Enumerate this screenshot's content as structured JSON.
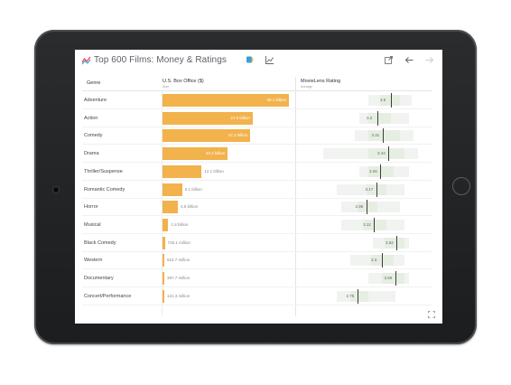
{
  "window": {
    "title": "Top 600 Films: Money & Ratings"
  },
  "icons": {
    "logo": "sparkline-logo-icon",
    "palette": "paint-bucket-icon",
    "chart": "chart-icon",
    "share": "share-icon",
    "back": "back-arrow-icon",
    "forward": "forward-arrow-icon",
    "expand": "expand-icon"
  },
  "colors": {
    "bar": "#f2b24c",
    "accent_logo": "#e2504c",
    "accent_palette": "#3aa0d8"
  },
  "columns": {
    "genre": "Genre",
    "box_office": "U.S. Box Office ($)",
    "box_office_sub": "Sum",
    "rating": "MovieLens Rating",
    "rating_sub": "Average"
  },
  "chart_data": {
    "type": "bar",
    "categories": [
      "Adventure",
      "Action",
      "Comedy",
      "Drama",
      "Thriller/Suspense",
      "Romantic Comedy",
      "Horror",
      "Musical",
      "Black Comedy",
      "Western",
      "Documentary",
      "Concert/Performance"
    ],
    "series": [
      {
        "name": "U.S. Box Office ($)",
        "values": [
          39.1,
          27.9,
          27.2,
          20.2,
          12.1,
          6.1,
          4.8,
          1.8,
          0.7461,
          0.5157,
          0.3977,
          0.1213
        ],
        "labels": [
          "39.1 billion",
          "27.9 billion",
          "27.2 billion",
          "20.2 billion",
          "12.1 billion",
          "6.1 billion",
          "4.8 billion",
          "1.8 billion",
          "746.1 million",
          "515.7 million",
          "397.7 million",
          "121.3 million"
        ]
      },
      {
        "name": "MovieLens Rating",
        "values": [
          3.5,
          3.2,
          3.31,
          3.44,
          3.26,
          3.17,
          2.95,
          3.12,
          3.62,
          3.3,
          3.59,
          2.75
        ],
        "labels": [
          "3.5",
          "3.2",
          "3.31",
          "3.44",
          "3.26",
          "3.17",
          "2.95",
          "3.12",
          "3.62",
          "3.3",
          "3.59",
          "2.75"
        ],
        "range": [
          [
            3.0,
            3.95
          ],
          [
            2.8,
            3.9
          ],
          [
            2.7,
            4.0
          ],
          [
            2.0,
            4.1
          ],
          [
            2.8,
            3.9
          ],
          [
            2.3,
            3.8
          ],
          [
            2.4,
            3.7
          ],
          [
            2.4,
            3.8
          ],
          [
            3.1,
            3.9
          ],
          [
            2.6,
            3.8
          ],
          [
            3.0,
            3.9
          ],
          [
            2.3,
            3.6
          ]
        ],
        "core": [
          [
            3.25,
            3.7
          ],
          [
            3.0,
            3.5
          ],
          [
            3.0,
            3.7
          ],
          [
            3.0,
            3.8
          ],
          [
            3.0,
            3.55
          ],
          [
            2.95,
            3.4
          ],
          [
            2.75,
            3.2
          ],
          [
            2.9,
            3.4
          ],
          [
            3.35,
            3.8
          ],
          [
            3.05,
            3.55
          ],
          [
            3.3,
            3.8
          ],
          [
            2.6,
            3.0
          ]
        ]
      }
    ],
    "box_office_max": 39.1,
    "rating_range": [
      1.5,
      4.5
    ]
  }
}
